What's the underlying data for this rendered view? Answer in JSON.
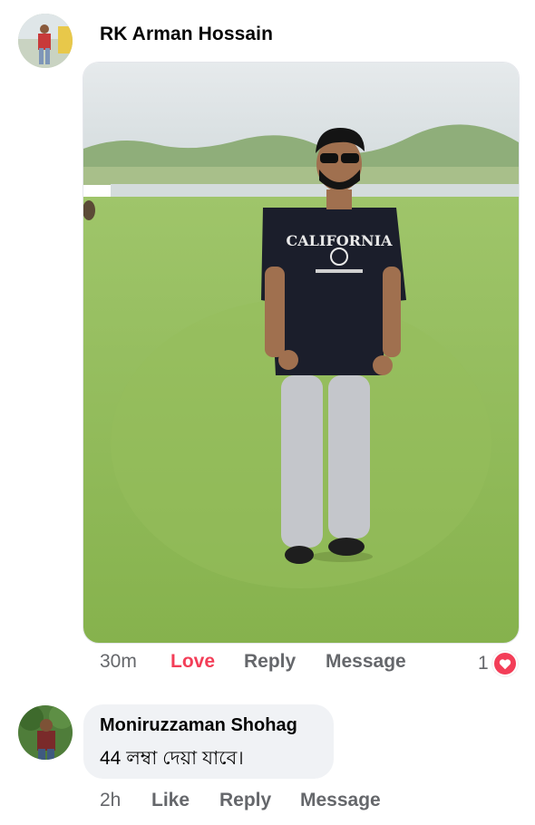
{
  "comment_main": {
    "author": "RK Arman Hossain",
    "avatar_icon": "user-avatar",
    "time": "30m",
    "reaction_label": "Love",
    "reaction_color": "#f33e58",
    "reply_label": "Reply",
    "message_label": "Message",
    "reaction_count": "1",
    "reaction_icon": "heart-icon"
  },
  "comment_reply": {
    "author": "Moniruzzaman Shohag",
    "avatar_icon": "user-avatar",
    "text": "44 লম্বা দেয়া যাবে।",
    "time": "2h",
    "like_label": "Like",
    "reply_label": "Reply",
    "message_label": "Message"
  },
  "colors": {
    "meta_text": "#65676b",
    "bubble_bg": "#f0f2f5",
    "love": "#f33e58"
  }
}
